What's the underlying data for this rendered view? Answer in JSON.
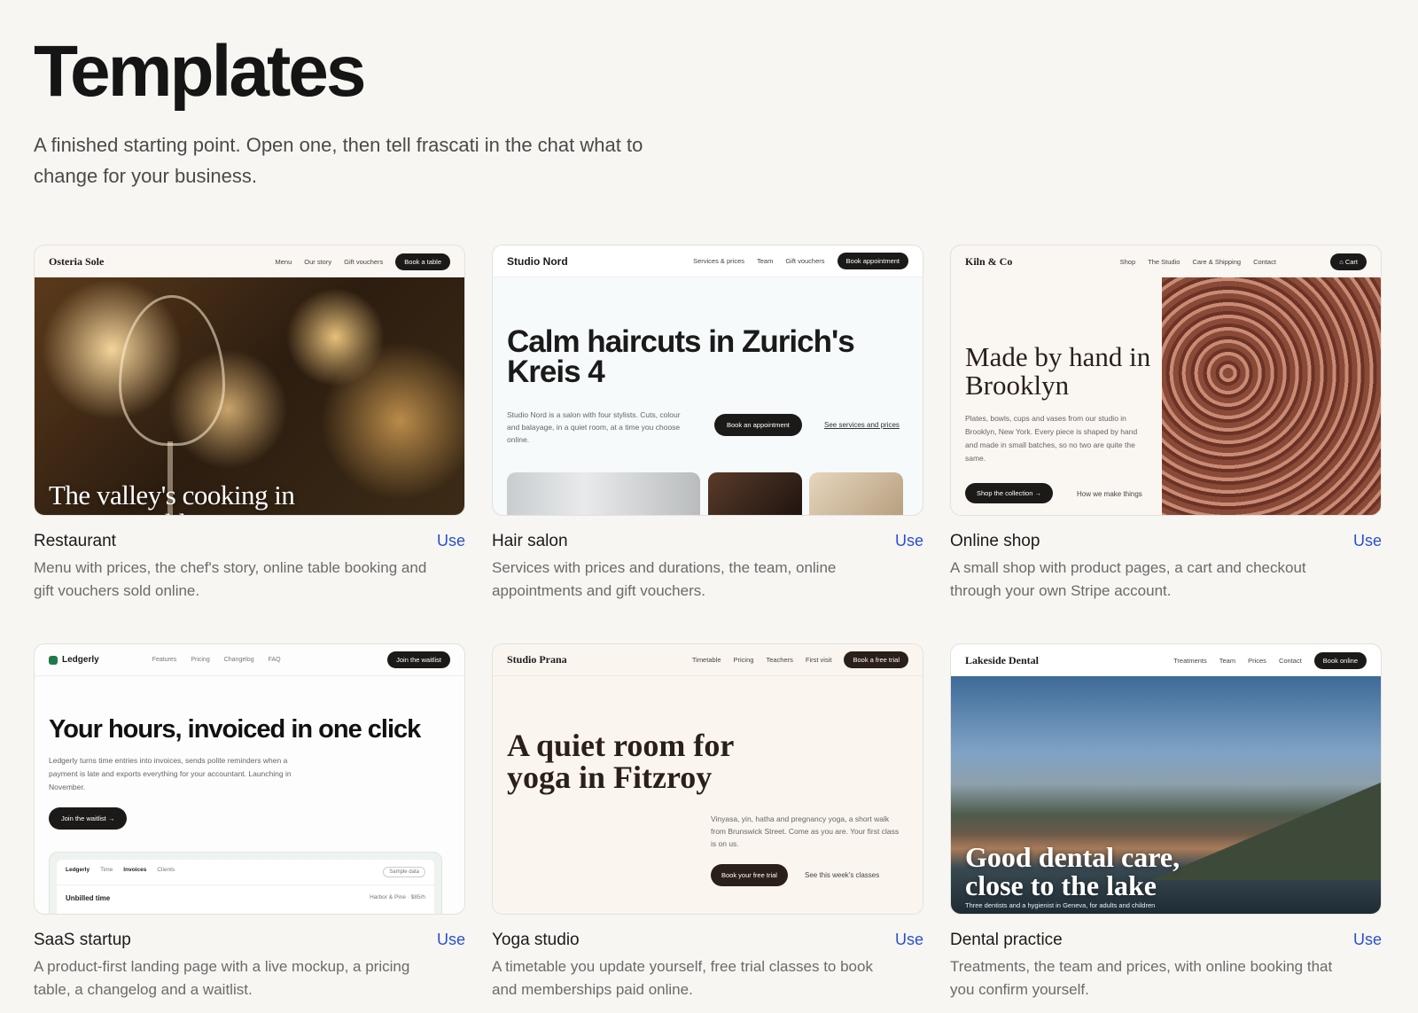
{
  "page": {
    "title": "Templates",
    "subtitle": "A finished starting point. Open one, then tell frascati in the chat what to change for your business."
  },
  "templates": [
    {
      "name": "Restaurant",
      "use_label": "Use",
      "description": "Menu with prices, the chef's story, online table booking and gift vouchers sold online.",
      "preview": {
        "brand": "Osteria Sole",
        "nav": [
          "Menu",
          "Our story",
          "Gift vouchers"
        ],
        "cta": "Book a table",
        "headline": "The valley's cooking in Lugano's old town"
      }
    },
    {
      "name": "Hair salon",
      "use_label": "Use",
      "description": "Services with prices and durations, the team, online appointments and gift vouchers.",
      "preview": {
        "brand": "Studio Nord",
        "nav": [
          "Services & prices",
          "Team",
          "Gift vouchers"
        ],
        "cta": "Book appointment",
        "headline": "Calm haircuts in Zurich's Kreis 4",
        "body": "Studio Nord is a salon with four stylists. Cuts, colour and balayage, in a quiet room, at a time you choose online.",
        "button": "Book an appointment",
        "link": "See services and prices"
      }
    },
    {
      "name": "Online shop",
      "use_label": "Use",
      "description": "A small shop with product pages, a cart and checkout through your own Stripe account.",
      "preview": {
        "brand": "Kiln & Co",
        "nav": [
          "Shop",
          "The Studio",
          "Care & Shipping",
          "Contact"
        ],
        "cta": "Cart",
        "headline": "Made by hand in Brooklyn",
        "body": "Plates, bowls, cups and vases from our studio in Brooklyn, New York. Every piece is shaped by hand and made in small batches, so no two are quite the same.",
        "button": "Shop the collection →",
        "link": "How we make things"
      }
    },
    {
      "name": "SaaS startup",
      "use_label": "Use",
      "description": "A product-first landing page with a live mockup, a pricing table, a changelog and a waitlist.",
      "preview": {
        "brand": "Ledgerly",
        "nav": [
          "Features",
          "Pricing",
          "Changelog",
          "FAQ"
        ],
        "cta": "Join the waitlist",
        "headline": "Your hours, invoiced in one click",
        "body": "Ledgerly turns time entries into invoices, sends polite reminders when a payment is late and exports everything for your accountant. Launching in November.",
        "button": "Join the waitlist →",
        "mock_tabs": [
          "Ledgerly",
          "Time",
          "Invoices",
          "Clients"
        ],
        "mock_badge": "Sample data",
        "mock_row": "Unbilled time",
        "mock_row_right": "Harbor & Pine · $85/h"
      }
    },
    {
      "name": "Yoga studio",
      "use_label": "Use",
      "description": "A timetable you update yourself, free trial classes to book and memberships paid online.",
      "preview": {
        "brand": "Studio Prana",
        "nav": [
          "Timetable",
          "Pricing",
          "Teachers",
          "First visit"
        ],
        "cta": "Book a free trial",
        "headline": "A quiet room for yoga in Fitzroy",
        "body": "Vinyasa, yin, hatha and pregnancy yoga, a short walk from Brunswick Street. Come as you are. Your first class is on us.",
        "button": "Book your free trial",
        "link": "See this week's classes"
      }
    },
    {
      "name": "Dental practice",
      "use_label": "Use",
      "description": "Treatments, the team and prices, with online booking that you confirm yourself.",
      "preview": {
        "brand": "Lakeside Dental",
        "nav": [
          "Treatments",
          "Team",
          "Prices",
          "Contact"
        ],
        "cta": "Book online",
        "headline": "Good dental care, close to the lake",
        "sub": "Three dentists and a hygienist in Geneva, for adults and children"
      }
    }
  ],
  "colors": {
    "background": "#f8f6f2",
    "link": "#2a4fd0",
    "dark_pill": "#1c1a18"
  }
}
